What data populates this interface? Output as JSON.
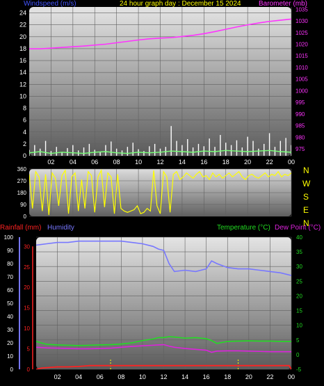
{
  "header": {
    "windspeed_label": "Windspeed (m/s)",
    "title": "24 hour graph day : December 15 2024",
    "barometer_label": "Barometer (mb)"
  },
  "compass": [
    "N",
    "W",
    "S",
    "E",
    "N"
  ],
  "lower_labels": {
    "rainfall": "Rainfall (mm)",
    "humidity": "Humidity",
    "temperature": "Temperature (°C)",
    "dewpoint": "Dew Point (°C)"
  },
  "colors": {
    "wind_axis": "#4455ff",
    "title": "#ffff00",
    "barometer": "#ff33ff",
    "wind_gust": "#ffffff",
    "wind_avg": "#77ff77",
    "direction": "#ffff00",
    "rainfall": "#ff2222",
    "humidity": "#7777ff",
    "temperature": "#22dd22",
    "dewpoint": "#dd22dd"
  },
  "chart_data": [
    {
      "type": "line",
      "name": "wind-barometer",
      "x_ticks": [
        "02",
        "04",
        "06",
        "08",
        "10",
        "12",
        "14",
        "16",
        "18",
        "20",
        "22",
        "00"
      ],
      "ylim_left": [
        0,
        25
      ],
      "y_ticks_left": [
        "0",
        "2",
        "4",
        "6",
        "8",
        "10",
        "12",
        "14",
        "16",
        "18",
        "20",
        "22",
        "24"
      ],
      "ylim_right": [
        972,
        1036
      ],
      "y_ticks_right": [
        "975",
        "980",
        "985",
        "990",
        "995",
        "1000",
        "1005",
        "1010",
        "1015",
        "1020",
        "1025",
        "1030",
        "1035"
      ],
      "series": [
        {
          "name": "Barometer (mb)",
          "axis": "right",
          "x": [
            0,
            1,
            2,
            3,
            4,
            5,
            6,
            7,
            8,
            9,
            10,
            11,
            12,
            13,
            14,
            15,
            16,
            17,
            18,
            19,
            20,
            21,
            22,
            23,
            24
          ],
          "y": [
            1018,
            1018,
            1018.3,
            1018.6,
            1018.9,
            1019.2,
            1019.6,
            1020,
            1020.6,
            1021.2,
            1021.8,
            1022.3,
            1022.6,
            1022.8,
            1023.3,
            1023.8,
            1024.5,
            1025.4,
            1026.4,
            1027.4,
            1028.3,
            1029.1,
            1029.8,
            1030.3,
            1030.8
          ]
        },
        {
          "name": "Windspeed (m/s)",
          "axis": "left",
          "x": [
            0,
            0.5,
            1,
            1.5,
            2,
            2.5,
            3,
            3.5,
            4,
            4.5,
            5,
            5.5,
            6,
            6.5,
            7,
            7.5,
            8,
            8.5,
            9,
            9.5,
            10,
            10.5,
            11,
            11.5,
            12,
            12.5,
            13,
            13.5,
            14,
            14.5,
            15,
            15.5,
            16,
            16.5,
            17,
            17.5,
            18,
            18.5,
            19,
            19.5,
            20,
            20.5,
            21,
            21.5,
            22,
            22.5,
            23,
            23.5,
            24
          ],
          "y": [
            1,
            1.8,
            1.2,
            2.5,
            0.8,
            1.5,
            0.6,
            1.3,
            1.8,
            0.9,
            1.4,
            2,
            1,
            0.6,
            1.8,
            2.4,
            1.2,
            0.9,
            1.5,
            2.2,
            1.1,
            0.8,
            1.6,
            2,
            1.2,
            1.5,
            5,
            2.5,
            1.8,
            2.8,
            1.4,
            2,
            1.6,
            2.9,
            1.5,
            3.5,
            2.2,
            1.8,
            2.6,
            1.4,
            3.2,
            2.5,
            1.2,
            2,
            3.8,
            1.5,
            2.5,
            3,
            1.8
          ]
        },
        {
          "name": "Wind average",
          "axis": "left",
          "x": [
            0,
            1,
            2,
            3,
            4,
            5,
            6,
            7,
            8,
            9,
            10,
            11,
            12,
            13,
            14,
            15,
            16,
            17,
            18,
            19,
            20,
            21,
            22,
            23,
            24
          ],
          "y": [
            0.5,
            0.7,
            0.4,
            0.6,
            0.5,
            0.4,
            0.6,
            0.7,
            0.5,
            0.4,
            0.6,
            0.5,
            0.6,
            0.8,
            0.7,
            0.6,
            0.8,
            0.7,
            0.9,
            0.8,
            0.7,
            0.8,
            0.9,
            0.7,
            0.6
          ]
        }
      ]
    },
    {
      "type": "scatter",
      "name": "wind-direction",
      "x_ticks": [],
      "ylim": [
        0,
        360
      ],
      "y_ticks": [
        "0",
        "90",
        "180",
        "270",
        "360"
      ],
      "series": [
        {
          "name": "Wind direction",
          "x": [
            0,
            0.3,
            0.6,
            0.9,
            1.2,
            1.5,
            1.8,
            2.1,
            2.4,
            2.7,
            3,
            3.3,
            3.6,
            3.9,
            4.2,
            4.5,
            4.8,
            5.1,
            5.4,
            5.7,
            6,
            6.3,
            6.6,
            6.9,
            7.2,
            7.5,
            7.8,
            8.1,
            8.4,
            8.7,
            9,
            9.3,
            9.6,
            9.9,
            10.2,
            10.5,
            10.8,
            11.1,
            11.4,
            11.7,
            12,
            12.3,
            12.6,
            12.9,
            13.2,
            13.5,
            13.8,
            14.1,
            14.4,
            14.7,
            15,
            15.3,
            15.6,
            15.9,
            16.2,
            16.5,
            16.8,
            17.1,
            17.4,
            17.7,
            18,
            18.3,
            18.6,
            18.9,
            19.2,
            19.5,
            19.8,
            20.1,
            20.4,
            20.7,
            21,
            21.3,
            21.6,
            21.9,
            22.2,
            22.5,
            22.8,
            23.1,
            23.4,
            23.7,
            24
          ],
          "y": [
            320,
            60,
            340,
            300,
            40,
            320,
            10,
            330,
            290,
            80,
            310,
            350,
            20,
            300,
            330,
            40,
            280,
            60,
            340,
            310,
            30,
            300,
            350,
            70,
            330,
            300,
            20,
            320,
            60,
            40,
            30,
            40,
            50,
            80,
            20,
            30,
            60,
            40,
            350,
            80,
            20,
            340,
            300,
            30,
            320,
            340,
            280,
            300,
            330,
            310,
            290,
            320,
            340,
            300,
            310,
            280,
            330,
            300,
            320,
            290,
            310,
            330,
            300,
            320,
            340,
            300,
            280,
            310,
            320,
            300,
            290,
            310,
            330,
            300,
            320,
            310,
            340,
            300,
            320,
            310,
            330
          ]
        }
      ]
    },
    {
      "type": "line",
      "name": "temperature-humidity",
      "x_ticks": [
        "02",
        "04",
        "06",
        "08",
        "10",
        "12",
        "14",
        "16",
        "18",
        "20",
        "22",
        "00"
      ],
      "ylim_left": [
        0,
        100
      ],
      "y_ticks_humidity": [
        "0",
        "10",
        "20",
        "30",
        "40",
        "50",
        "60",
        "70",
        "80",
        "90",
        "100"
      ],
      "y_ticks_rain": [
        "0",
        "5",
        "10",
        "15",
        "20",
        "25",
        "30"
      ],
      "ylim_right": [
        -5,
        40
      ],
      "y_ticks_right": [
        "-5",
        "0",
        "5",
        "10",
        "15",
        "20",
        "25",
        "30",
        "35",
        "40"
      ],
      "series": [
        {
          "name": "Humidity",
          "axis": "left",
          "x": [
            0,
            1,
            2,
            3,
            4,
            5,
            6,
            7,
            8,
            9,
            10,
            11,
            11.5,
            12,
            12.5,
            13,
            14,
            15,
            16,
            16.5,
            17,
            18,
            19,
            20,
            21,
            22,
            23,
            24
          ],
          "y": [
            94,
            95,
            96,
            96,
            97,
            97,
            97,
            97,
            97,
            96,
            95,
            93,
            91,
            90,
            80,
            74,
            75,
            74,
            76,
            82,
            80,
            77,
            76,
            76,
            75,
            74,
            73,
            71
          ]
        },
        {
          "name": "Temperature (°C)",
          "axis": "right",
          "x": [
            0,
            1,
            2,
            3,
            4,
            5,
            6,
            7,
            8,
            9,
            10,
            11,
            11.5,
            12,
            12.5,
            13,
            14,
            15,
            16,
            16.5,
            17,
            18,
            19,
            20,
            21,
            22,
            23,
            24
          ],
          "y": [
            4.5,
            3.5,
            3.3,
            3.2,
            3.1,
            3.2,
            3.3,
            3.4,
            3.6,
            4,
            4.8,
            5.3,
            5.8,
            5.8,
            6.1,
            6,
            5.6,
            5.8,
            5.4,
            4.8,
            3.8,
            4.5,
            4.6,
            4.7,
            4.6,
            4.6,
            4.5,
            4.5
          ]
        },
        {
          "name": "Dew Point (°C)",
          "axis": "right",
          "x": [
            0,
            1,
            2,
            3,
            4,
            5,
            6,
            7,
            8,
            9,
            10,
            11,
            11.5,
            12,
            12.5,
            13,
            14,
            15,
            16,
            16.5,
            17,
            18,
            19,
            20,
            21,
            22,
            23,
            24
          ],
          "y": [
            2.5,
            2.3,
            2.2,
            2.1,
            2.0,
            2.0,
            2.1,
            2.2,
            2.5,
            2.8,
            3.0,
            3.2,
            3.3,
            3.4,
            2.9,
            2.5,
            2.1,
            1.8,
            1.5,
            0.8,
            1.2,
            1.3,
            1.3,
            1.2,
            1.1,
            1.0,
            1.0,
            1.0
          ]
        },
        {
          "name": "Rainfall (mm)",
          "axis": "left_rain",
          "x": [
            0,
            0.5,
            1,
            2,
            3,
            4,
            5,
            6,
            7,
            8,
            9,
            10,
            11,
            12,
            13,
            14,
            15,
            16,
            17,
            18,
            19,
            20,
            21,
            22,
            23,
            23.8,
            24
          ],
          "y": [
            0,
            0.3,
            0.4,
            0.6,
            0.6,
            0.7,
            0.9,
            0.9,
            0.9,
            0.9,
            0.9,
            0.9,
            0.9,
            0.9,
            0.9,
            0.9,
            0.9,
            0.9,
            0.9,
            0.9,
            0.9,
            0.9,
            0.9,
            0.9,
            0.9,
            0.9,
            0
          ]
        }
      ]
    }
  ]
}
